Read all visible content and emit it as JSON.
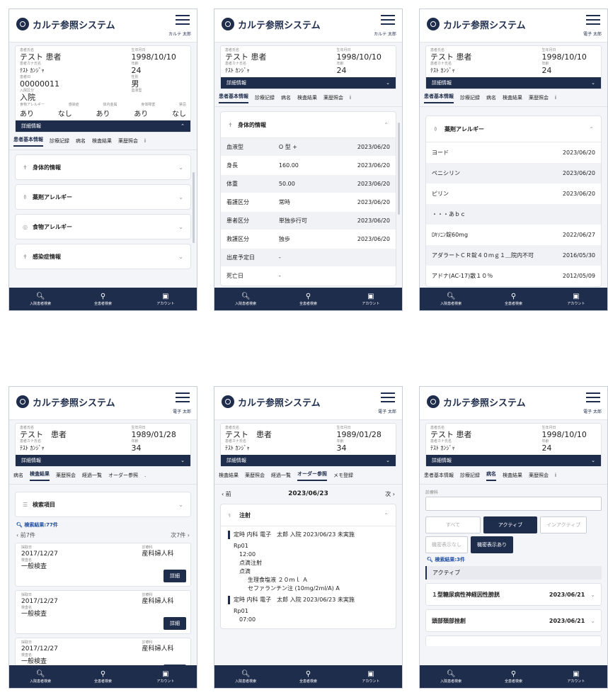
{
  "app_title": "カルテ参照システム",
  "user": "カルテ 太郎",
  "user2": "電子 太郎",
  "labels": {
    "name": "患者氏名",
    "kana": "患者カナ氏名",
    "birth": "生年月日",
    "age": "年齢",
    "id": "患者ID",
    "sex": "性別",
    "adm": "入院区分",
    "block": "血液型",
    "allergy_food": "食物アレルギー",
    "allergy_drug": "感染症",
    "implant": "体内金属",
    "disability": "身体障害",
    "alert": "禁忌"
  },
  "patient": {
    "name": "テスト 患者",
    "kana": "ﾃｽﾄ ｶﾝｼﾞｬ",
    "birth": "1998/10/10",
    "age": "24",
    "id": "00000011",
    "sex": "男",
    "adm": "入院",
    "flags": [
      "あり",
      "なし",
      "あり",
      "あり",
      "なし"
    ]
  },
  "patient2": {
    "name": "テスト　患者",
    "kana": "ﾃｽﾄ ｶﾝｼﾞｬ",
    "birth": "1989/01/28",
    "age": "34"
  },
  "detail_label": "詳細情報",
  "tabs_a": [
    "患者基本情報",
    "診療記録",
    "病名",
    "検査結果",
    "薬歴照会",
    "i"
  ],
  "tabs_b": [
    "病名",
    "検査結果",
    "薬歴照会",
    "経過一覧",
    "オーダー参照",
    "."
  ],
  "tabs_c": [
    "検査結果",
    "薬歴照会",
    "経過一覧",
    "オーダー参照",
    "メモ登録"
  ],
  "sections": [
    "身体的情報",
    "薬剤アレルギー",
    "食物アレルギー",
    "感染症情報"
  ],
  "body_info": [
    [
      "血液型",
      "O 型 +",
      "2023/06/20"
    ],
    [
      "身長",
      "160.00",
      "2023/06/20"
    ],
    [
      "体重",
      "50.00",
      "2023/06/20"
    ],
    [
      "看護区分",
      "常時",
      "2023/06/20"
    ],
    [
      "患者区分",
      "単独歩行可",
      "2023/06/20"
    ],
    [
      "救護区分",
      "独歩",
      "2023/06/20"
    ],
    [
      "出産予定日",
      "-",
      ""
    ],
    [
      "死亡日",
      "-",
      ""
    ]
  ],
  "drug_allergy": [
    [
      "ヨード",
      "2023/06/20"
    ],
    [
      "ペニシリン",
      "2023/06/20"
    ],
    [
      "ピリン",
      "2023/06/20"
    ],
    [
      "・・・あｂｃ",
      ""
    ],
    [
      "ﾛｷｿﾆﾝ錠60mg",
      "2022/06/27"
    ],
    [
      "アダラートＣＲ錠４０ｍｇ１＿院内不可",
      "2016/05/30"
    ],
    [
      "アドナ(AC-17)散１０％",
      "2012/05/09"
    ]
  ],
  "search_items": "検索項目",
  "search_result": "検索結果:77件",
  "prev7": "前7件",
  "next7": "次7件",
  "lab_labels": {
    "date": "採取日",
    "dept": "診療科",
    "name": "検査名"
  },
  "lab_rows": [
    {
      "date": "2017/12/27",
      "dept": "産科婦人科",
      "name": "一般検査"
    },
    {
      "date": "2017/12/27",
      "dept": "産科婦人科",
      "name": "一般検査"
    },
    {
      "date": "2017/12/27",
      "dept": "産科婦人科",
      "name": "一般検査"
    }
  ],
  "detail_btn": "詳細",
  "order": {
    "prev": "前",
    "next": "次",
    "date": "2023/06/23",
    "section": "注射",
    "entry1": "定時 内科 電子　太郎 入院 2023/06/23 未実施",
    "rp": "Rp01",
    "time1": "12:00",
    "l1": "点滴注射",
    "l2": "点滴",
    "l3": "生理食塩液 ２０ｍｌ Ａ",
    "l4": "セファランチン注 (10mg/2ml/A) A",
    "entry2": "定時 内科 電子　太郎 入院 2023/06/23 未実施",
    "time2": "07:00"
  },
  "disease": {
    "dept_label": "診療科",
    "f_all": "すべて",
    "f_active": "アクティブ",
    "f_inactive": "インアクティブ",
    "f_hide": "機密表示なし",
    "f_show": "機密表示あり",
    "count": "検索結果:3件",
    "group": "アクティブ",
    "items": [
      [
        "１型糖尿病性神経因性膀胱",
        "2023/06/21"
      ],
      [
        "頭部頚部挫創",
        "2023/06/21"
      ]
    ]
  },
  "bottom_nav": [
    "入院患者検索",
    "全患者検索",
    "アカウント"
  ],
  "colors": {
    "navy": "#1f2d4d",
    "bg": "#f4f5f8"
  }
}
